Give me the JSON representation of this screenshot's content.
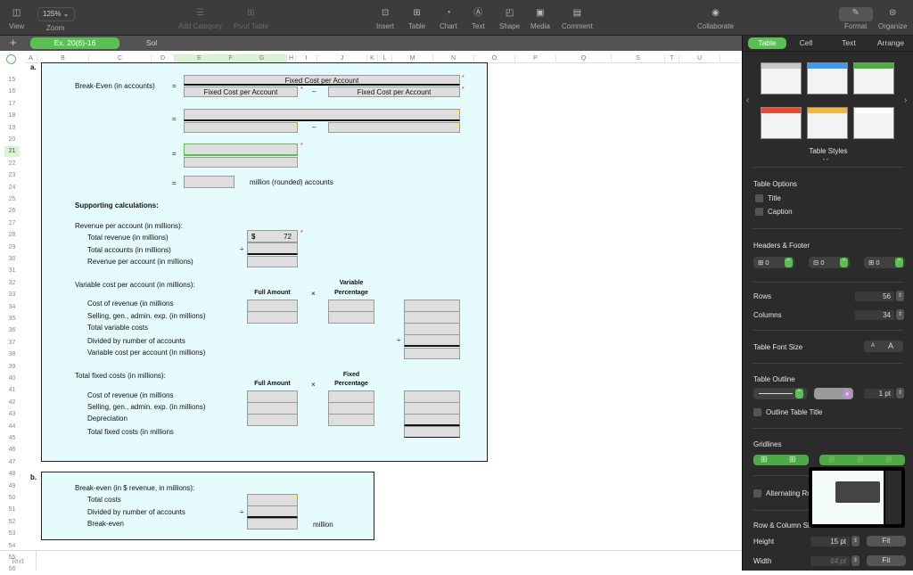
{
  "toolbar": {
    "view": {
      "label": "View",
      "icon": "sidebar-icon"
    },
    "zoom": {
      "label": "Zoom",
      "value": "125%"
    },
    "add_category": {
      "label": "Add Category"
    },
    "pivot_table": {
      "label": "Pivot Table"
    },
    "insert": {
      "label": "Insert"
    },
    "table": {
      "label": "Table"
    },
    "chart": {
      "label": "Chart"
    },
    "text": {
      "label": "Text"
    },
    "shape": {
      "label": "Shape"
    },
    "media": {
      "label": "Media"
    },
    "comment": {
      "label": "Comment"
    },
    "collaborate": {
      "label": "Collaborate"
    },
    "format": {
      "label": "Format"
    },
    "organize": {
      "label": "Organize"
    }
  },
  "sheet_tabs": [
    {
      "label": "Ex. 20(6)-16",
      "active": true
    },
    {
      "label": "Sol",
      "active": false
    }
  ],
  "columns": [
    "A",
    "B",
    "C",
    "D",
    "E",
    "F",
    "G",
    "H",
    "I",
    "J",
    "K",
    "L",
    "M",
    "N",
    "O",
    "P",
    "Q",
    "S",
    "T",
    "U"
  ],
  "rows": [
    "15",
    "16",
    "17",
    "18",
    "19",
    "20",
    "21",
    "22",
    "23",
    "24",
    "25",
    "26",
    "27",
    "28",
    "29",
    "30",
    "31",
    "32",
    "33",
    "34",
    "35",
    "36",
    "37",
    "38",
    "39",
    "40",
    "41",
    "42",
    "43",
    "44",
    "45",
    "46",
    "47",
    "48",
    "49",
    "50",
    "51",
    "52",
    "53",
    "54",
    "55",
    "56"
  ],
  "selected_row": "21",
  "part_a": {
    "label": "a.",
    "breakeven_label": "Break-Even (in accounts)",
    "eq": "=",
    "minus": "–",
    "numerator": "Fixed Cost per Account",
    "denominator_left": "Fixed Cost per Account",
    "denominator_right": "Fixed Cost per Account",
    "result_suffix": "million (rounded) accounts",
    "supporting": "Supporting calculations:",
    "revenue": {
      "heading": "Revenue per account (in millions):",
      "lines": [
        "Total revenue (in millions)",
        "Total accounts (in millions)",
        "Revenue per account (in millions)"
      ],
      "currency": "$",
      "total_revenue": "72",
      "op": "÷"
    },
    "variable": {
      "heading": "Variable cost per account (in millions):",
      "col1": "Full Amount",
      "times": "×",
      "col2_line1": "Variable",
      "col2_line2": "Percentage",
      "lines": [
        "Cost of revenue (in millions",
        "Selling, gen., admin. exp. (in millions)",
        "Total variable costs",
        "Divided by number of accounts",
        "Variable cost per account (in millions)"
      ],
      "op": "÷"
    },
    "fixed": {
      "heading": "Total fixed costs (in millions):",
      "col1": "Full Amount",
      "times": "×",
      "col2_line1": "Fixed",
      "col2_line2": "Percentage",
      "lines": [
        "Cost of revenue (in millions",
        "Selling, gen., admin. exp. (in millions)",
        "Depreciation",
        "Total fixed costs (in millions"
      ]
    }
  },
  "part_b": {
    "label": "b.",
    "heading": "Break-even (in $ revenue, in millions):",
    "lines": [
      "Total costs",
      "Divided by number of accounts",
      "Break-even"
    ],
    "op": "÷",
    "suffix": "million"
  },
  "footer": {
    "label": "Text"
  },
  "sidebar": {
    "tabs": [
      "Table",
      "Cell",
      "Text",
      "Arrange"
    ],
    "active_tab": "Table",
    "table_styles_label": "Table Styles",
    "style_header_colors": [
      "#c8c8c8",
      "#3f97ef",
      "#4caf3f",
      "#e8482c",
      "#f2b43b",
      "#ffffff"
    ],
    "table_options": {
      "heading": "Table Options",
      "title": "Title",
      "caption": "Caption"
    },
    "headers_footer": {
      "heading": "Headers & Footer",
      "header_rows": "0",
      "header_cols": "0",
      "footer_rows": "0"
    },
    "rows": {
      "label": "Rows",
      "value": "56"
    },
    "columns": {
      "label": "Columns",
      "value": "34"
    },
    "font_size": {
      "label": "Table Font Size",
      "smaller": "A",
      "larger": "A"
    },
    "outline": {
      "heading": "Table Outline",
      "width": "1 pt",
      "outline_title": "Outline Table Title"
    },
    "gridlines": {
      "heading": "Gridlines"
    },
    "alternating": {
      "label": "Alternating Row Color"
    },
    "row_col_size": {
      "heading": "Row & Column Size",
      "height_label": "Height",
      "height_value": "15 pt",
      "width_label": "Width",
      "width_value": "64 pt",
      "fit": "Fit"
    }
  }
}
